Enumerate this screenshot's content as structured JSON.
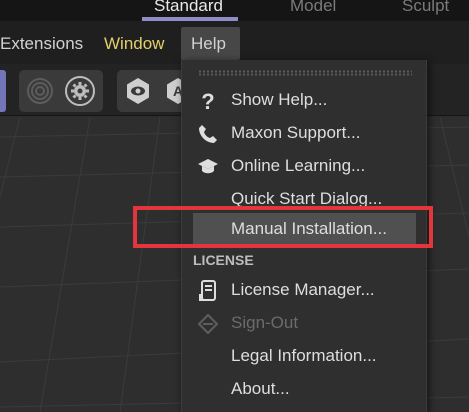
{
  "layout_tabs": [
    {
      "label": "Standard",
      "active": true
    },
    {
      "label": "Model",
      "active": false
    },
    {
      "label": "Sculpt",
      "active": false
    }
  ],
  "menubar": {
    "items": [
      {
        "label": "Extensions"
      },
      {
        "label": "Window"
      },
      {
        "label": "Help"
      }
    ]
  },
  "toolbar": {
    "buttons": [
      {
        "icon": "target-icon"
      },
      {
        "icon": "gear-icon"
      },
      {
        "icon": "eye-hexagon-icon"
      },
      {
        "icon": "a-hexagon-icon"
      }
    ]
  },
  "help_menu": {
    "items": [
      {
        "label": "Show Help...",
        "icon": "question-mark-icon"
      },
      {
        "label": "Maxon Support...",
        "icon": "phone-icon"
      },
      {
        "label": "Online Learning...",
        "icon": "graduation-cap-icon"
      },
      {
        "label": "Quick Start Dialog...",
        "icon": ""
      },
      {
        "label": "Manual Installation...",
        "icon": "",
        "selected": true
      }
    ],
    "license_section": "LICENSE",
    "license_items": [
      {
        "label": "License Manager...",
        "icon": "document-license-icon"
      },
      {
        "label": "Sign-Out",
        "icon": "sign-out-icon",
        "disabled": true
      },
      {
        "label": "Legal Information...",
        "icon": ""
      },
      {
        "label": "About...",
        "icon": ""
      }
    ]
  },
  "colors": {
    "highlight_box": "#e3353b",
    "active_tab_underline": "#8e8ec6",
    "window_menu_text": "#e3d06a"
  }
}
